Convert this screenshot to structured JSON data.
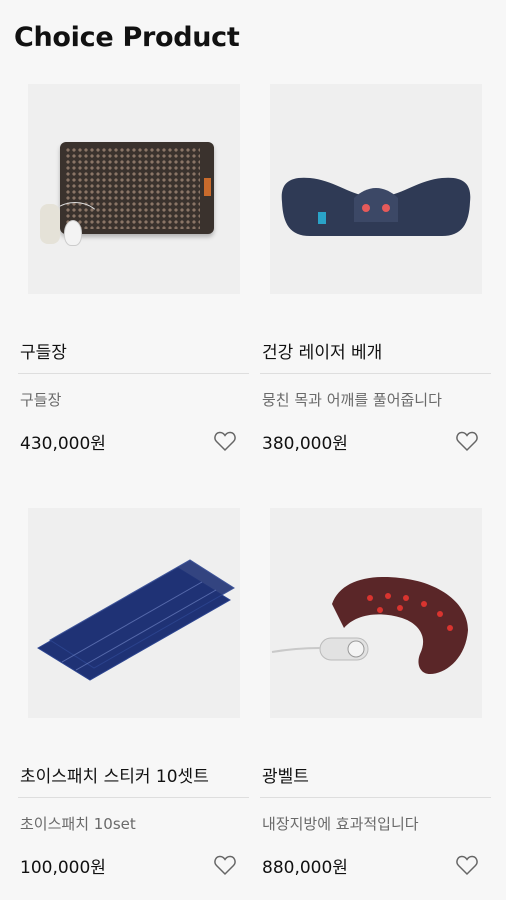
{
  "section_title": "Choice Product",
  "products": [
    {
      "name": "구들장",
      "desc": "구들장",
      "price": "430,000원"
    },
    {
      "name": "건강 레이저 베개",
      "desc": "뭉친 목과 어깨를 풀어줍니다",
      "price": "380,000원"
    },
    {
      "name": "초이스패치 스티커 10셋트",
      "desc": "초이스패치 10set",
      "price": "100,000원"
    },
    {
      "name": "광벨트",
      "desc": "내장지방에 효과적입니다",
      "price": "880,000원"
    }
  ],
  "icons": {
    "wishlist": "heart-outline-icon"
  },
  "colors": {
    "background": "#f7f7f7",
    "muted_text": "#6a6a6a",
    "divider": "#dedede"
  }
}
